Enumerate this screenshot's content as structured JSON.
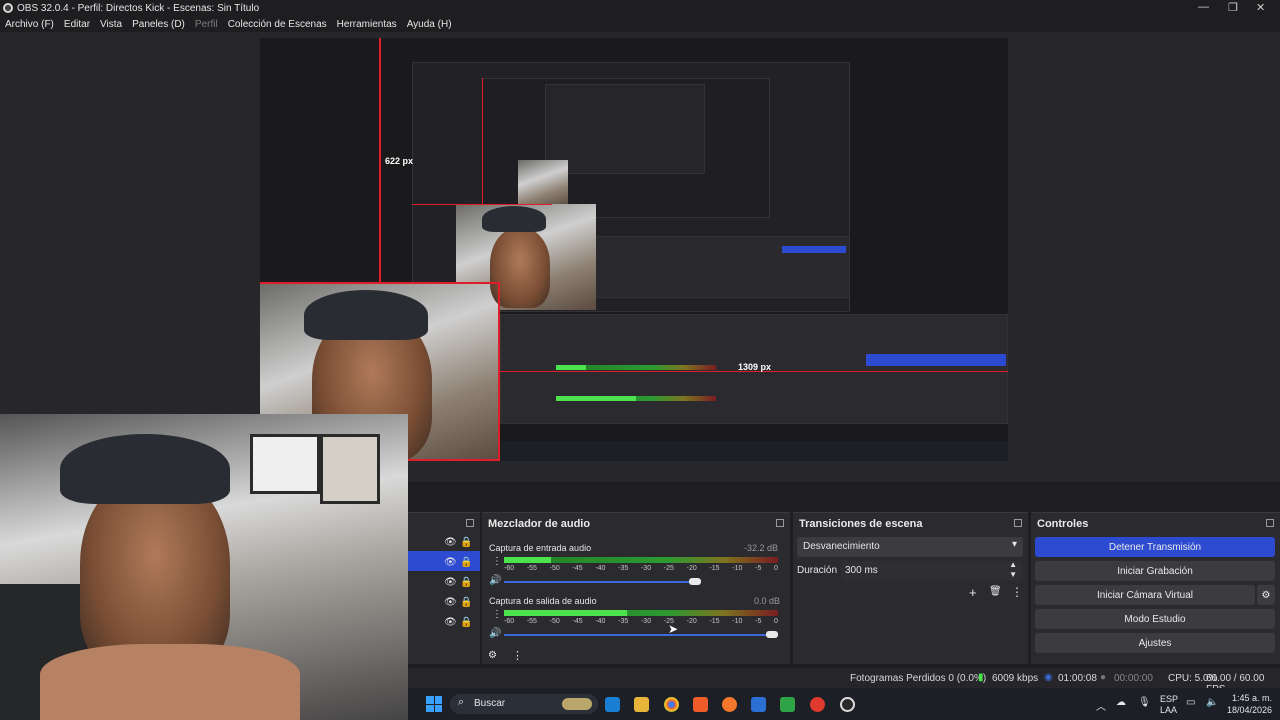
{
  "window": {
    "title": "OBS 32.0.4 - Perfil: Directos Kick - Escenas: Sin Título",
    "controls": [
      "—",
      "❐",
      "✕"
    ]
  },
  "menu": [
    "Archivo (F)",
    "Editar",
    "Vista",
    "Paneles (D)",
    "Perfil",
    "Colección de Escenas",
    "Herramientas",
    "Ayuda (H)"
  ],
  "preview": {
    "guide_vertical_label": "622 px",
    "guide_horizontal_label": "1309 px"
  },
  "audio_mixer": {
    "title": "Mezclador de audio",
    "ticks": [
      "-60",
      "-55",
      "-50",
      "-45",
      "-40",
      "-35",
      "-30",
      "-25",
      "-20",
      "-15",
      "-10",
      "-5",
      "0"
    ],
    "channels": [
      {
        "name": "Captura de entrada audio",
        "db": "-32.2 dB",
        "level": 0.17,
        "volume": 0.72
      },
      {
        "name": "Captura de salida de audio",
        "db": "0.0 dB",
        "level": 0.45,
        "volume": 1.0
      }
    ]
  },
  "transitions": {
    "title": "Transiciones de escena",
    "selected": "Desvanecimiento",
    "duration_label": "Duración",
    "duration_value": "300 ms"
  },
  "controls": {
    "title": "Controles",
    "buttons": [
      "Detener Transmisión",
      "Iniciar Grabación",
      "Iniciar Cámara Virtual",
      "Modo Estudio",
      "Ajustes"
    ]
  },
  "status": {
    "dropped_frames": "Fotogramas Perdidos 0 (0.0%)",
    "bitrate": "6009 kbps",
    "stream_time": "01:00:08",
    "record_time": "00:00:00",
    "cpu": "CPU: 5.0%",
    "fps": "60.00 / 60.00 FPS"
  },
  "taskbar": {
    "search_placeholder": "Buscar",
    "lang": "ESP",
    "lang_sub": "LAA",
    "time": "1:45 a. m.",
    "date": "18/04/2026"
  },
  "colors": {
    "accent": "#2d4bd0",
    "guide_red": "#e01e2b",
    "meter_green": "#4ce34e"
  }
}
